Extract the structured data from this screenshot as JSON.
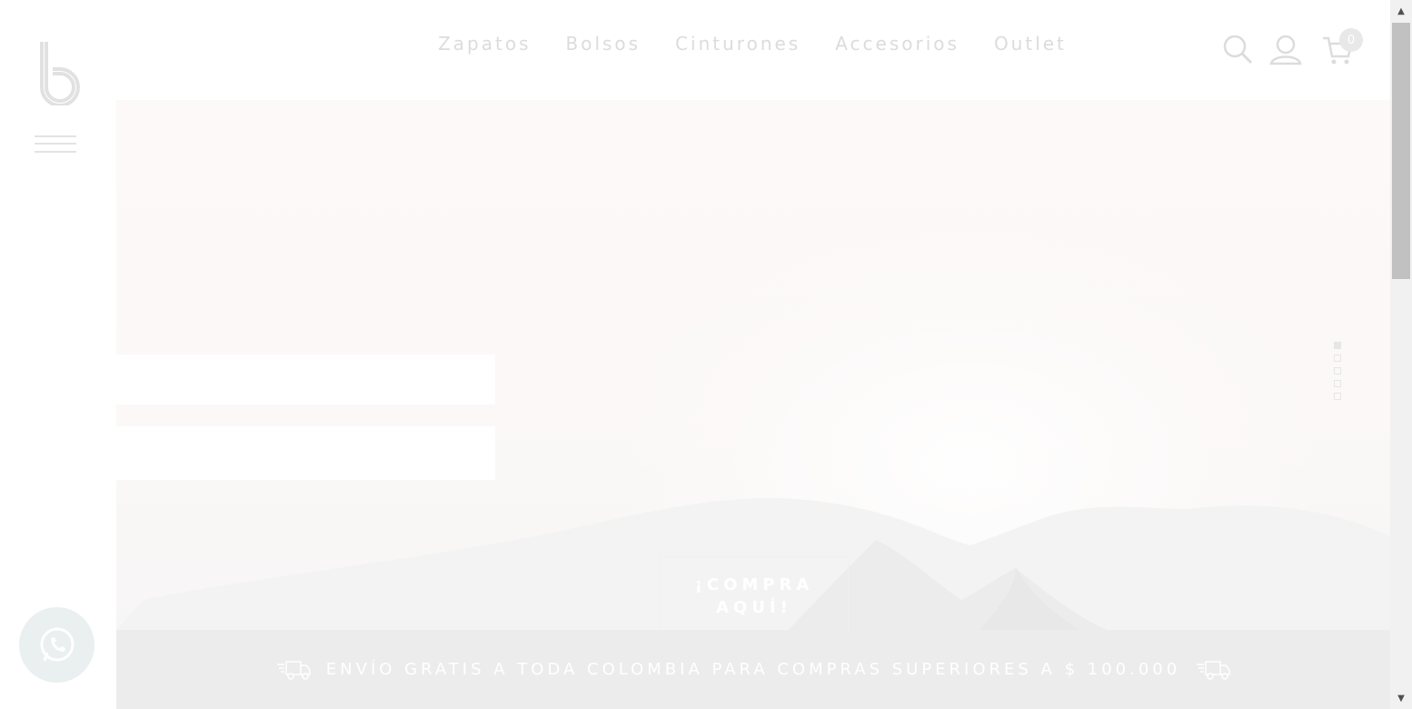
{
  "brand": {
    "logo_icon": "b-logo-icon"
  },
  "menu": {
    "icon": "hamburger-icon"
  },
  "nav": {
    "items": [
      {
        "label": "Zapatos"
      },
      {
        "label": "Bolsos"
      },
      {
        "label": "Cinturones"
      },
      {
        "label": "Accesorios"
      },
      {
        "label": "Outlet"
      }
    ]
  },
  "header_icons": {
    "search": "search-icon",
    "account": "user-icon",
    "cart": "cart-icon",
    "cart_count": "0"
  },
  "hero": {
    "cta_line1": "¡COMPRA",
    "cta_line2": "AQUÍ!",
    "slides_total": 5,
    "active_slide": 1
  },
  "shipping_banner": {
    "text": "ENVÍO GRATIS A TODA COLOMBIA PARA COMPRAS SUPERIORES A $ 100.000",
    "icon": "delivery-truck-icon"
  },
  "whatsapp": {
    "icon": "whatsapp-icon"
  },
  "colors": {
    "nav_text": "#dcdcdc",
    "banner_bg": "#ececec",
    "hero_bg": "#fcf9f8"
  }
}
